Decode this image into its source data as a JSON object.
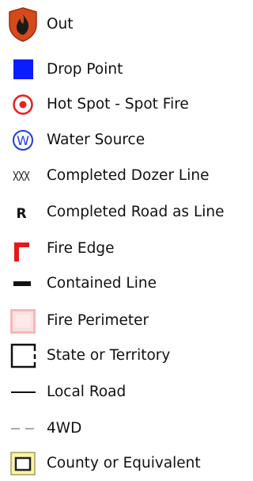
{
  "legend": {
    "items": [
      {
        "label": "Out",
        "icon": "fire-out-icon"
      },
      {
        "label": "Drop Point",
        "icon": "drop-point-icon"
      },
      {
        "label": "Hot Spot - Spot Fire",
        "icon": "hot-spot-icon"
      },
      {
        "label": "Water Source",
        "icon": "water-source-icon"
      },
      {
        "label": "Completed Dozer Line",
        "icon": "dozer-line-icon"
      },
      {
        "label": "Completed Road as Line",
        "icon": "road-as-line-icon",
        "glyph": "R"
      },
      {
        "label": "Fire Edge",
        "icon": "fire-edge-icon"
      },
      {
        "label": "Contained Line",
        "icon": "contained-line-icon"
      },
      {
        "label": "Fire Perimeter",
        "icon": "fire-perimeter-icon"
      },
      {
        "label": "State or Territory",
        "icon": "state-territory-icon"
      },
      {
        "label": "Local Road",
        "icon": "local-road-icon"
      },
      {
        "label": "4WD",
        "icon": "four-wd-icon"
      },
      {
        "label": "County or Equivalent",
        "icon": "county-icon"
      }
    ]
  },
  "colors": {
    "fire_out_fill": "#d44a1c",
    "drop_point": "#0a1dff",
    "hot_spot": "#e5211d",
    "water_source": "#1c3de0",
    "fire_edge": "#e81717",
    "fire_perimeter_fill": "#fde0e0",
    "fire_perimeter_border": "#f7b8b8",
    "county_fill": "#fbf3a8",
    "county_border": "#7a7420",
    "four_wd": "#aaaaaa"
  }
}
